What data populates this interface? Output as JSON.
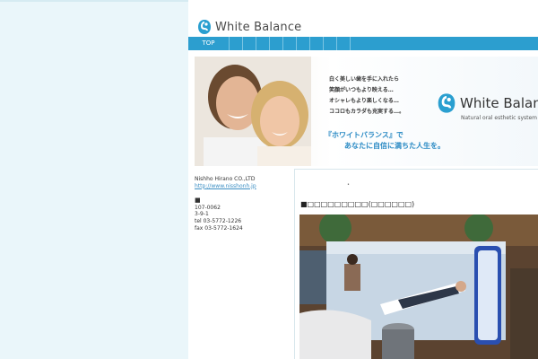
{
  "brand": {
    "name": "White Balance"
  },
  "nav": {
    "items": [
      {
        "label": "TOP"
      }
    ]
  },
  "banner": {
    "copy_lines": [
      "白く美しい歯を手に入れたら",
      "笑顔がいつもより映える…",
      "オシャレもより楽しくなる…",
      "ココロもカラダも充実する…。"
    ],
    "tagline": [
      "『ホワイトバランス』で",
      "あなたに自信に満ちた人生を。"
    ],
    "brand_name": "White Balance",
    "brand_sub": "Natural oral esthetic system"
  },
  "sidebar": {
    "company": "Nishho Hirano CO.,LTD",
    "website": "http://www.nisshonh.jp",
    "square": "■",
    "postal": "107-0062",
    "address": "3-9-1",
    "tel": "tel 03-5772-1226",
    "fax": "fax 03-5772-1624"
  },
  "main": {
    "dot": "•",
    "heading": "■□□□□□□□□□(□□□□□□)"
  },
  "colors": {
    "nav": "#2c9ecf",
    "page_bg": "#eaf6fa",
    "accent": "#2a8ac4"
  }
}
